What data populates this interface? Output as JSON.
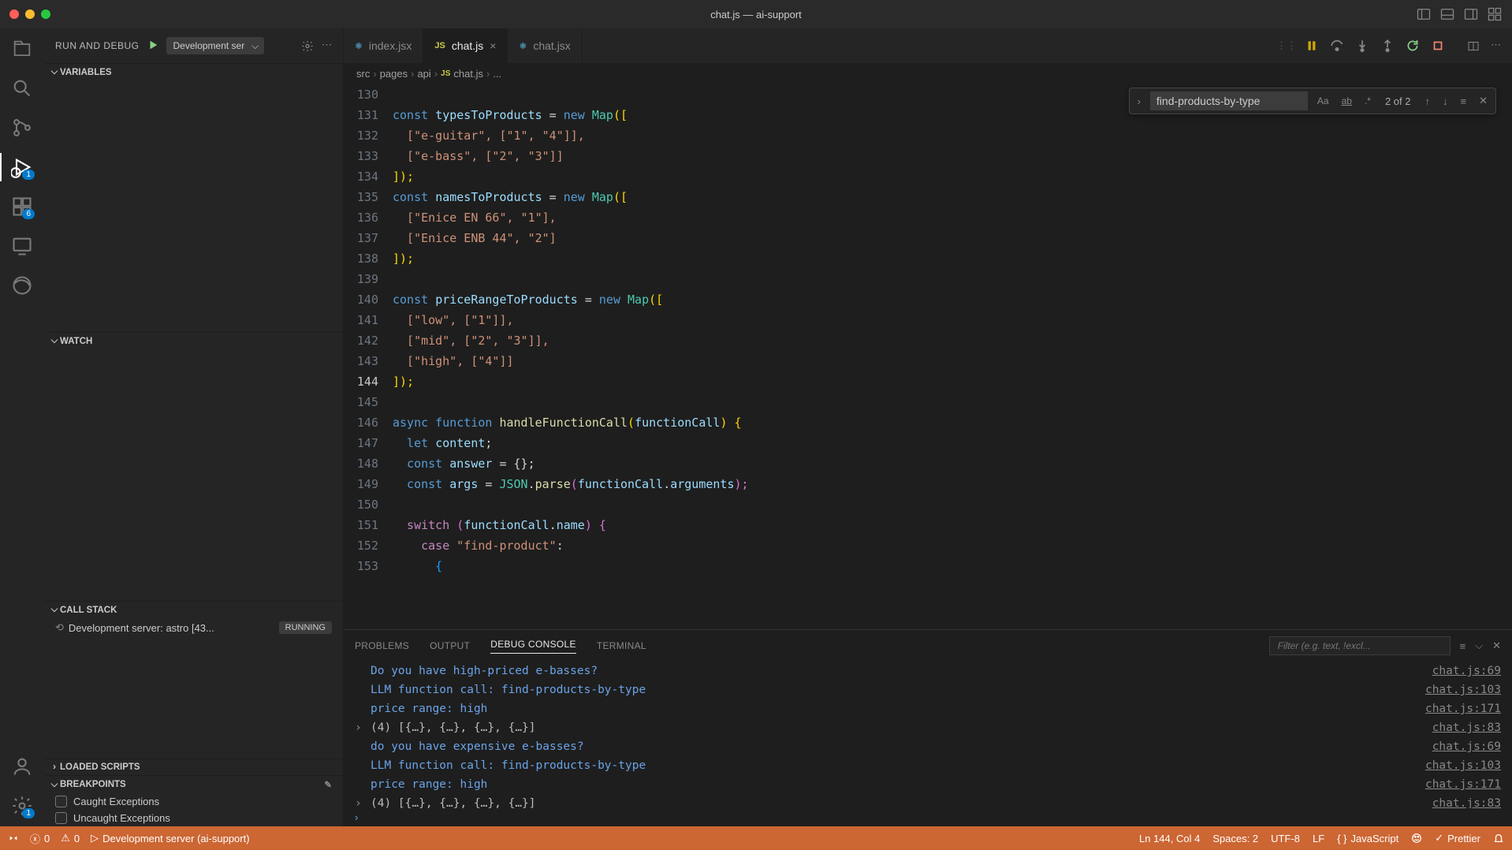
{
  "window": {
    "title": "chat.js — ai-support"
  },
  "debugHeader": {
    "title": "RUN AND DEBUG",
    "config": "Development ser"
  },
  "sections": {
    "variables": "VARIABLES",
    "watch": "WATCH",
    "callstack": "CALL STACK",
    "loadedScripts": "LOADED SCRIPTS",
    "breakpoints": "BREAKPOINTS"
  },
  "callstack": {
    "item": "Development server: astro [43...",
    "status": "RUNNING"
  },
  "breakpoints": {
    "caught": "Caught Exceptions",
    "uncaught": "Uncaught Exceptions"
  },
  "tabs": {
    "t1": "index.jsx",
    "t2": "chat.js",
    "t3": "chat.jsx"
  },
  "breadcrumb": {
    "p1": "src",
    "p2": "pages",
    "p3": "api",
    "p4": "chat.js",
    "p5": "..."
  },
  "find": {
    "value": "find-products-by-type",
    "count": "2 of 2"
  },
  "lineNumbers": [
    "130",
    "131",
    "132",
    "133",
    "134",
    "135",
    "136",
    "137",
    "138",
    "139",
    "140",
    "141",
    "142",
    "143",
    "144",
    "145",
    "146",
    "147",
    "148",
    "149",
    "150",
    "151",
    "152",
    "153"
  ],
  "activeLine": "144",
  "code": {
    "l131a": "const ",
    "l131b": "typesToProducts",
    "l131c": " = ",
    "l131d": "new ",
    "l131e": "Map",
    "l131f": "([",
    "l132": "  [\"e-guitar\", [\"1\", \"4\"]],",
    "l133": "  [\"e-bass\", [\"2\", \"3\"]]",
    "l134": "]);",
    "l135a": "const ",
    "l135b": "namesToProducts",
    "l135c": " = ",
    "l135d": "new ",
    "l135e": "Map",
    "l135f": "([",
    "l136": "  [\"Enice EN 66\", \"1\"],",
    "l137": "  [\"Enice ENB 44\", \"2\"]",
    "l138": "]);",
    "l140a": "const ",
    "l140b": "priceRangeToProducts",
    "l140c": " = ",
    "l140d": "new ",
    "l140e": "Map",
    "l140f": "([",
    "l141": "  [\"low\", [\"1\"]],",
    "l142": "  [\"mid\", [\"2\", \"3\"]],",
    "l143": "  [\"high\", [\"4\"]]",
    "l144": "]);",
    "l146a": "async function ",
    "l146b": "handleFunctionCall",
    "l146c": "(",
    "l146d": "functionCall",
    "l146e": ") {",
    "l147a": "  let ",
    "l147b": "content",
    "l147c": ";",
    "l148a": "  const ",
    "l148b": "answer",
    "l148c": " = {};",
    "l149a": "  const ",
    "l149b": "args",
    "l149c": " = ",
    "l149d": "JSON",
    "l149e": ".",
    "l149f": "parse",
    "l149g": "(",
    "l149h": "functionCall",
    "l149i": ".",
    "l149j": "arguments",
    "l149k": ");",
    "l151a": "  switch ",
    "l151b": "(",
    "l151c": "functionCall",
    "l151d": ".",
    "l151e": "name",
    "l151f": ") {",
    "l152a": "    case ",
    "l152b": "\"find-product\"",
    "l152c": ":",
    "l153": "      {"
  },
  "panel": {
    "tabs": {
      "problems": "PROBLEMS",
      "output": "OUTPUT",
      "debug": "DEBUG CONSOLE",
      "terminal": "TERMINAL"
    },
    "filterPlaceholder": "Filter (e.g. text, !excl..."
  },
  "console": {
    "l1": "Do you have high-priced e-basses?",
    "s1": "chat.js:69",
    "l2": "LLM function call:  find-products-by-type",
    "s2": "chat.js:103",
    "l3": "price range:  high",
    "s3": "chat.js:171",
    "l4": "(4) [{…}, {…}, {…}, {…}]",
    "s4": "chat.js:83",
    "l5": "do you have expensive e-basses?",
    "s5": "chat.js:69",
    "l6": "LLM function call:  find-products-by-type",
    "s6": "chat.js:103",
    "l7": "price range:  high",
    "s7": "chat.js:171",
    "l8": "(4) [{…}, {…}, {…}, {…}]",
    "s8": "chat.js:83"
  },
  "statusbar": {
    "errors": "0",
    "warnings": "0",
    "server": "Development server (ai-support)",
    "lncol": "Ln 144, Col 4",
    "spaces": "Spaces: 2",
    "encoding": "UTF-8",
    "eol": "LF",
    "lang": "JavaScript",
    "prettier": "Prettier"
  },
  "badges": {
    "debug": "1",
    "ext": "6",
    "remote": "1"
  }
}
